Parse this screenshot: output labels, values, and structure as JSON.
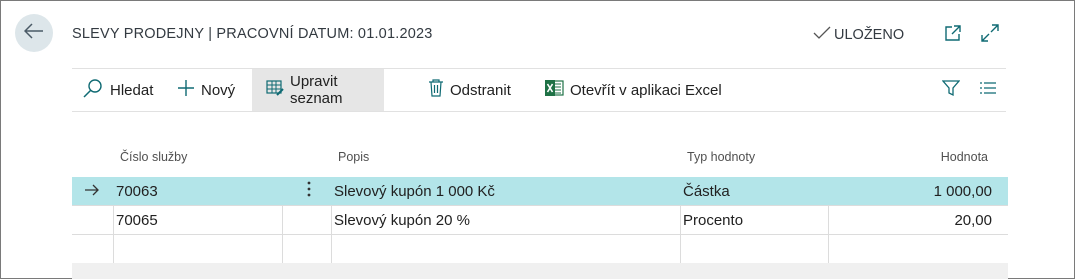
{
  "header": {
    "title": "SLEVY PRODEJNY | PRACOVNÍ DATUM: 01.01.2023",
    "saved_label": "ULOŽENO"
  },
  "icons": {
    "back": "arrow-left-icon",
    "saved": "checkmark-icon",
    "open_new": "open-in-new-window-icon",
    "expand": "expand-icon",
    "search": "search-icon",
    "new": "plus-icon",
    "edit_list": "edit-list-icon",
    "delete": "trash-icon",
    "excel": "excel-icon",
    "filter": "filter-icon",
    "list_view": "list-view-icon",
    "row_selected": "arrow-right-icon",
    "row_menu": "more-vertical-icon"
  },
  "toolbar": {
    "search_label": "Hledat",
    "new_label": "Nový",
    "edit_list_label": "Upravit seznam",
    "delete_label": "Odstranit",
    "excel_label": "Otevřít v aplikaci Excel"
  },
  "columns": {
    "service_no": "Číslo služby",
    "description": "Popis",
    "value_type": "Typ hodnoty",
    "value": "Hodnota"
  },
  "rows": [
    {
      "service_no": "70063",
      "description": "Slevový kupón 1 000 Kč",
      "value_type": "Částka",
      "value": "1 000,00"
    },
    {
      "service_no": "70065",
      "description": "Slevový kupón 20 %",
      "value_type": "Procento",
      "value": "20,00"
    }
  ],
  "colors": {
    "selected_row": "#b3e5e9",
    "back_button_bg": "#dde6ea",
    "excel_green": "#1e7145",
    "accent": "#0f6a73"
  }
}
